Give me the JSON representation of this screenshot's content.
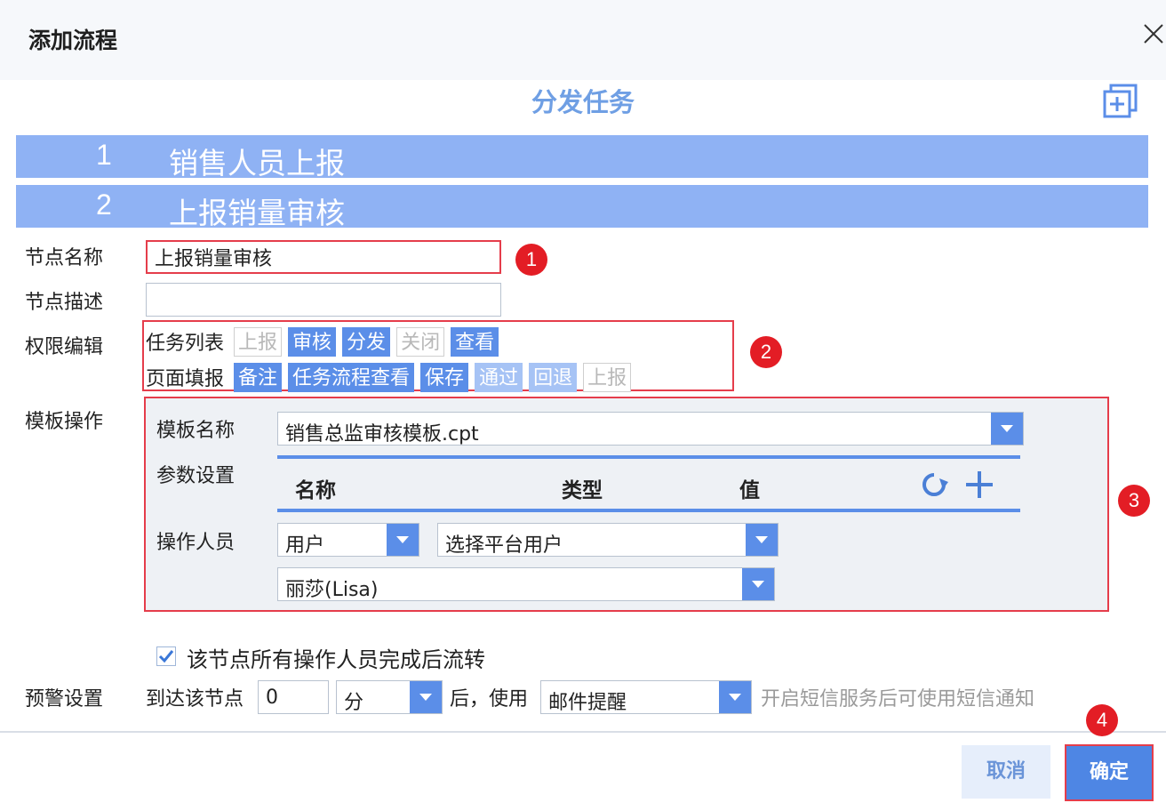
{
  "dialog": {
    "title": "添加流程"
  },
  "flow": {
    "title": "分发任务",
    "steps": [
      {
        "num": "1",
        "name": "销售人员上报"
      },
      {
        "num": "2",
        "name": "上报销量审核"
      }
    ]
  },
  "form": {
    "node_name": {
      "label": "节点名称",
      "value": "上报销量审核"
    },
    "node_desc": {
      "label": "节点描述",
      "value": ""
    },
    "permissions": {
      "label": "权限编辑",
      "task_list": {
        "label": "任务列表",
        "tags": [
          {
            "text": "上报",
            "state": "off"
          },
          {
            "text": "审核",
            "state": "on"
          },
          {
            "text": "分发",
            "state": "on"
          },
          {
            "text": "关闭",
            "state": "off"
          },
          {
            "text": "查看",
            "state": "on"
          }
        ]
      },
      "page_fill": {
        "label": "页面填报",
        "tags": [
          {
            "text": "备注",
            "state": "on"
          },
          {
            "text": "任务流程查看",
            "state": "on"
          },
          {
            "text": "保存",
            "state": "on"
          },
          {
            "text": "通过",
            "state": "light"
          },
          {
            "text": "回退",
            "state": "light"
          },
          {
            "text": "上报",
            "state": "off"
          }
        ]
      }
    },
    "template": {
      "label": "模板操作",
      "name_label": "模板名称",
      "name_value": "销售总监审核模板.cpt",
      "params_label": "参数设置",
      "params_columns": {
        "name": "名称",
        "type": "类型",
        "value": "值"
      },
      "operator_label": "操作人员",
      "operator_type": "用户",
      "operator_select": "选择平台用户",
      "operator_user": "丽莎(Lisa)"
    },
    "auto_flow": {
      "checked": true,
      "label": "该节点所有操作人员完成后流转"
    },
    "warning": {
      "label": "预警设置",
      "prefix": "到达该节点",
      "amount": "0",
      "unit": "分",
      "mid": "后，使用",
      "method": "邮件提醒",
      "hint": "开启短信服务后可使用短信通知"
    }
  },
  "markers": [
    "1",
    "2",
    "3",
    "4"
  ],
  "footer": {
    "cancel": "取消",
    "confirm": "确定"
  },
  "colors": {
    "accent": "#5b8ee8",
    "step_bar": "#8fb2f4",
    "highlight": "#e53d4b",
    "marker": "#e31d25"
  }
}
